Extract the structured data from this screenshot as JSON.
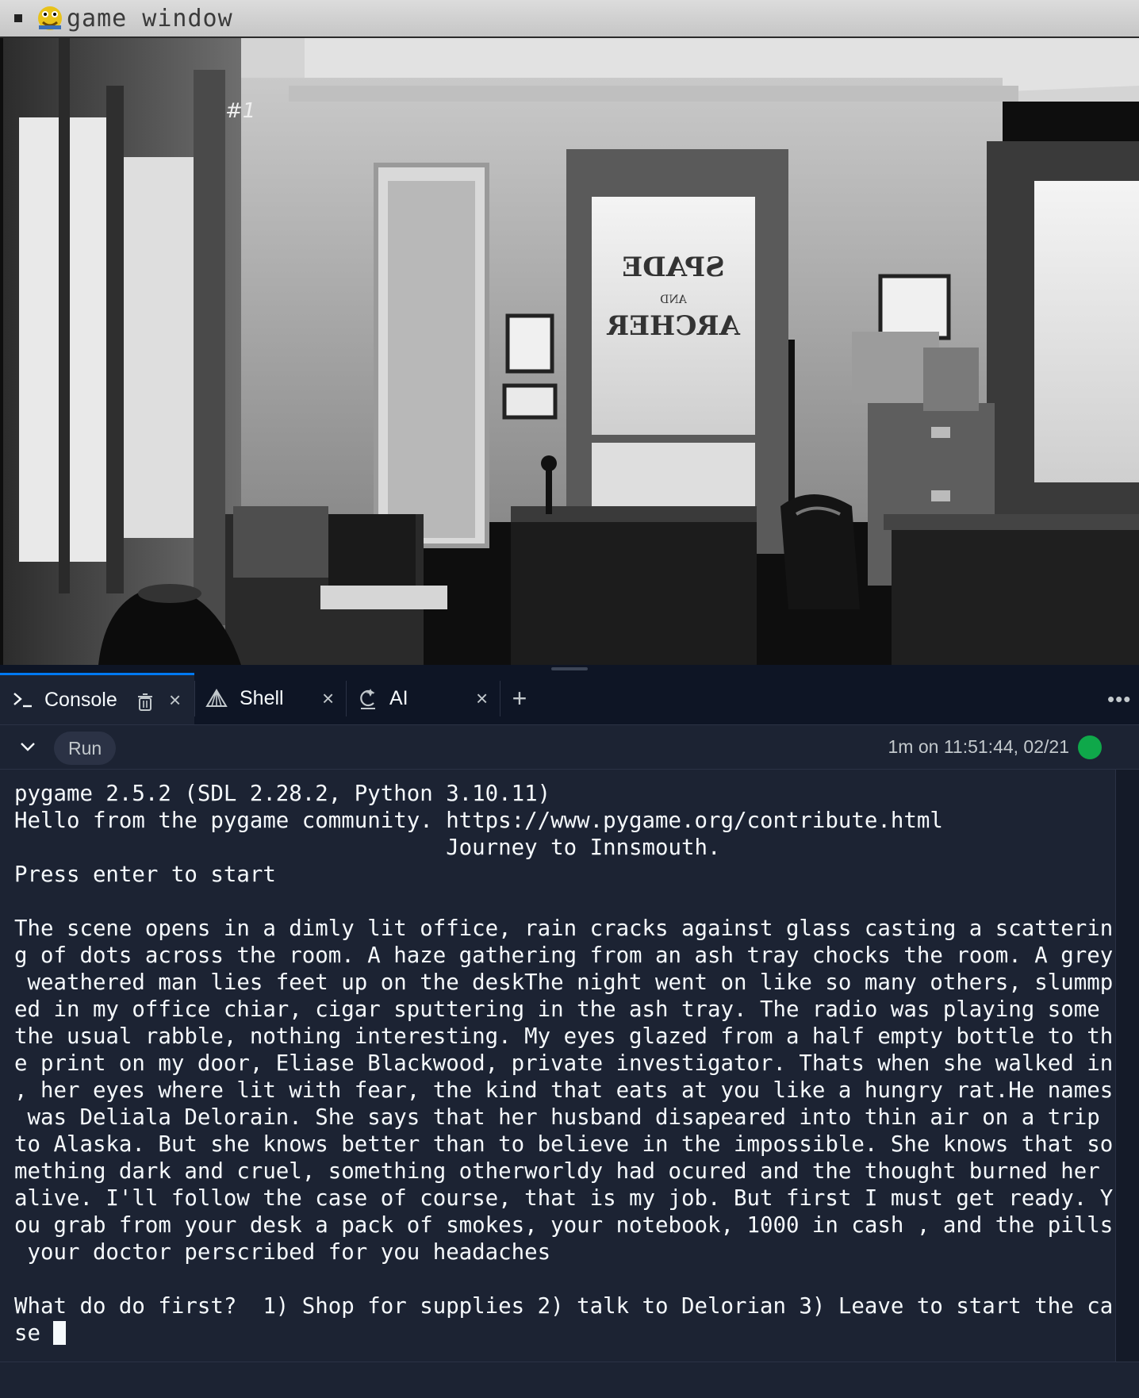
{
  "game_window": {
    "title": "game window",
    "title_icon": "pygame-snake-icon",
    "menu_icon": "window-menu-icon",
    "scene": {
      "description_icon": "office-scene-image",
      "door_sign": [
        "SPADE",
        "AND",
        "ARCHER"
      ],
      "photo_mark": "#1"
    }
  },
  "tabs": [
    {
      "label": "Console",
      "icon": "terminal-prompt-icon",
      "active": true
    },
    {
      "label": "Shell",
      "icon": "shell-icon",
      "active": false
    },
    {
      "label": "AI",
      "icon": "ai-icon",
      "active": false
    }
  ],
  "toolbar": {
    "run_label": "Run",
    "status": "1m on 11:51:44, 02/21",
    "status_color": "#0fa84a"
  },
  "console": {
    "lines": [
      "pygame 2.5.2 (SDL 2.28.2, Python 3.10.11)",
      "Hello from the pygame community. https://www.pygame.org/contribute.html",
      "                                 Journey to Innsmouth.",
      "Press enter to start",
      "",
      "The scene opens in a dimly lit office, rain cracks against glass casting a scatterin",
      "g of dots across the room. A haze gathering from an ash tray chocks the room. A grey",
      " weathered man lies feet up on the deskThe night went on like so many others, slummp",
      "ed in my office chiar, cigar sputtering in the ash tray. The radio was playing some",
      "the usual rabble, nothing interesting. My eyes glazed from a half empty bottle to th",
      "e print on my door, Eliase Blackwood, private investigator. Thats when she walked in",
      ", her eyes where lit with fear, the kind that eats at you like a hungry rat.He names",
      " was Deliala Delorain. She says that her husband disapeared into thin air on a trip",
      "to Alaska. But she knows better than to believe in the impossible. She knows that so",
      "mething dark and cruel, something otherworldy had ocured and the thought burned her",
      "alive. I'll follow the case of course, that is my job. But first I must get ready. Y",
      "ou grab from your desk a pack of smokes, your notebook, 1000 in cash , and the pills",
      " your doctor perscribed for you headaches",
      "",
      "What do do first?  1) Shop for supplies 2) talk to Delorian 3) Leave to start the ca",
      "se "
    ]
  },
  "colors": {
    "accent": "#0079f2",
    "background": "#1c2333",
    "tabbar": "#0e1525",
    "text": "#f5f9fc"
  }
}
